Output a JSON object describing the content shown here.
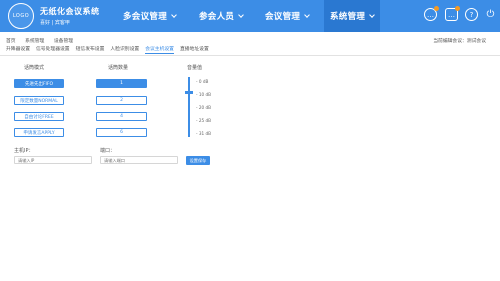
{
  "header": {
    "logo_text": "LOGO",
    "app_title": "无纸化会议系统",
    "user_line": "喜好 | 宾客甲",
    "nav": [
      {
        "label": "多会议管理"
      },
      {
        "label": "参会人员"
      },
      {
        "label": "会议管理"
      },
      {
        "label": "系统管理"
      }
    ],
    "icons": [
      "message-icon",
      "notification-icon",
      "help-icon",
      "power-icon"
    ]
  },
  "breadcrumb": [
    "首页",
    "系统管理",
    "设备管理"
  ],
  "current_conference": "当前编辑会议：测试会议",
  "tabs": [
    {
      "label": "升降器设置"
    },
    {
      "label": "信号处理器设置"
    },
    {
      "label": "短信发布设置"
    },
    {
      "label": "人脸识别设置"
    },
    {
      "label": "会议主机设置"
    },
    {
      "label": "直播地址设置"
    }
  ],
  "columns": {
    "mode": "话筒模式",
    "value": "话筒数量",
    "volume": "音量值"
  },
  "modes": [
    {
      "label": "先进先出FIFO"
    },
    {
      "label": "限定数量NORMAL"
    },
    {
      "label": "自由讨论FREE"
    },
    {
      "label": "申请发言APPLY"
    }
  ],
  "values": [
    "1",
    "2",
    "4",
    "6"
  ],
  "slider": {
    "ticks": [
      "- 0 dB",
      "- 10 dB",
      "- 20 dB",
      "- 25 dB",
      "- 31 dB"
    ],
    "level_db": -10
  },
  "host_ip": {
    "label": "主机IP：",
    "placeholder": "请输入IP"
  },
  "port": {
    "label": "端口：",
    "placeholder": "请输入端口"
  },
  "set_button": "设置保存",
  "colors": {
    "accent": "#3c8de6",
    "accent_dark": "#2a78d1",
    "badge": "#f59a23"
  }
}
